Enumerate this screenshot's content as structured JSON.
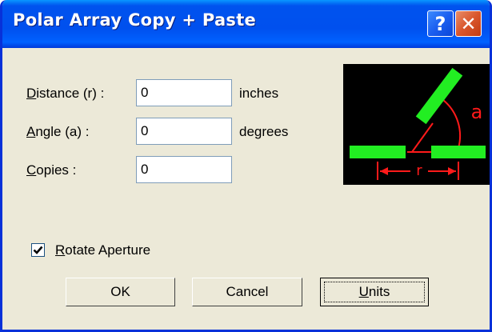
{
  "window": {
    "title": "Polar Array Copy + Paste",
    "help_label": "?",
    "close_label": "✕"
  },
  "fields": {
    "distance": {
      "label_mnemonic": "D",
      "label_rest": "istance (r) :",
      "value": "0",
      "unit": "inches"
    },
    "angle": {
      "label_mnemonic": "A",
      "label_rest": "ngle (a) :",
      "value": "0",
      "unit": "degrees"
    },
    "copies": {
      "label_mnemonic": "C",
      "label_rest": "opies :",
      "value": "0"
    }
  },
  "rotate_aperture": {
    "checked": true,
    "label_mnemonic": "R",
    "label_rest": "otate Aperture"
  },
  "buttons": {
    "ok": "OK",
    "cancel": "Cancel",
    "units_mnemonic": "U",
    "units_rest": "nits"
  },
  "diagram": {
    "angle_label": "a",
    "distance_label": "r",
    "colors": {
      "background": "#000000",
      "bars": "#22ee22",
      "annotations": "#ff1a1a"
    }
  }
}
